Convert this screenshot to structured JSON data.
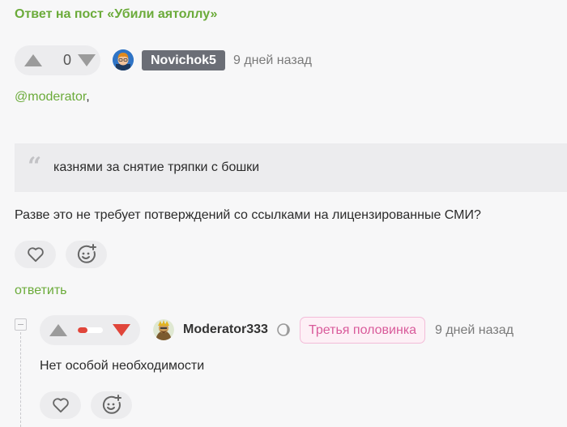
{
  "post": {
    "title": "Ответ на пост «Убили аятоллу»"
  },
  "comment1": {
    "rating": "0",
    "author": "Novichok5",
    "time": "9 дней назад",
    "mention": "@moderator",
    "mention_suffix": ",",
    "quote": "казнями за снятие тряпки с бошки",
    "text": "Разве это не требует потверждений со ссылками на лицензированные СМИ?",
    "reply_label": "ответить"
  },
  "comment2": {
    "author": "Moderator333",
    "tag": "Третья половинка",
    "time": "9 дней назад",
    "text": "Нет особой необходимости",
    "upvote_fraction": 0.4
  },
  "icons": {
    "upvote": "triangle-up-icon",
    "downvote": "triangle-down-icon",
    "like": "heart-icon",
    "react": "smile-plus-icon",
    "quote": "quote-icon",
    "moderator": "moderator-shield-icon",
    "collapse": "collapse-minus-icon"
  },
  "colors": {
    "accent_green": "#6bab3a",
    "downvote_red": "#e0453a",
    "tag_pink": "#d95a9a"
  }
}
